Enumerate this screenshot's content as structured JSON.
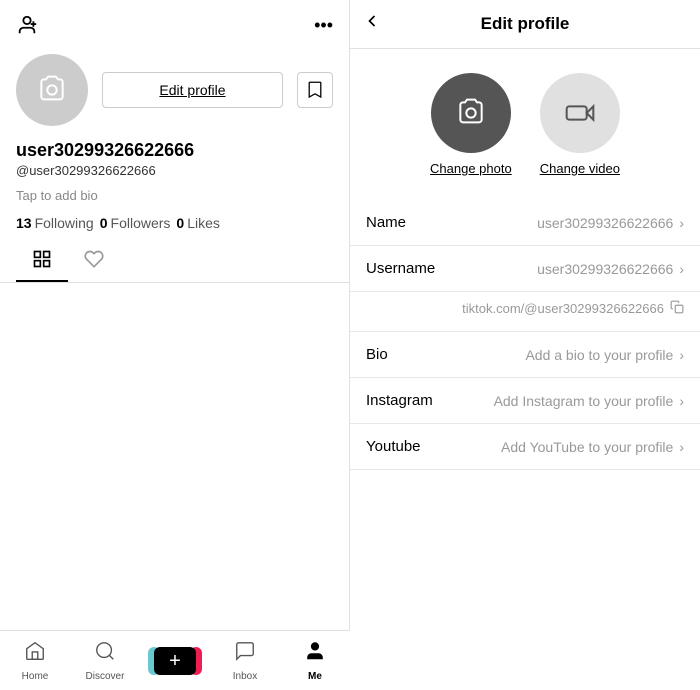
{
  "left": {
    "header": {
      "add_user_icon": "👤+",
      "more_icon": "•••"
    },
    "profile": {
      "camera_icon": "📷",
      "edit_profile_btn": "Edit profile",
      "bookmark_icon": "🔖",
      "username": "user30299326622666",
      "handle": "@user30299326622666",
      "bio_placeholder": "Tap to add bio",
      "stats": {
        "following_count": "13",
        "following_label": "Following",
        "followers_count": "0",
        "followers_label": "Followers",
        "likes_count": "0",
        "likes_label": "Likes"
      }
    },
    "tabs": {
      "posts_icon": "|||",
      "liked_icon": "♡"
    }
  },
  "bottom_nav": {
    "home_label": "Home",
    "discover_label": "Discover",
    "inbox_label": "Inbox",
    "me_label": "Me",
    "plus_label": "+"
  },
  "right": {
    "header": {
      "back_icon": "‹",
      "title": "Edit profile"
    },
    "photo_options": {
      "change_photo_label": "Change photo",
      "change_video_label": "Change video"
    },
    "fields": [
      {
        "label": "Name",
        "value": "user30299326622666"
      },
      {
        "label": "Username",
        "value": "user30299326622666"
      },
      {
        "label": "Bio",
        "value": "Add a bio to your profile"
      },
      {
        "label": "Instagram",
        "value": "Add Instagram to your profile"
      },
      {
        "label": "Youtube",
        "value": "Add YouTube to your profile"
      }
    ],
    "url": "tiktok.com/@user30299326622666"
  }
}
